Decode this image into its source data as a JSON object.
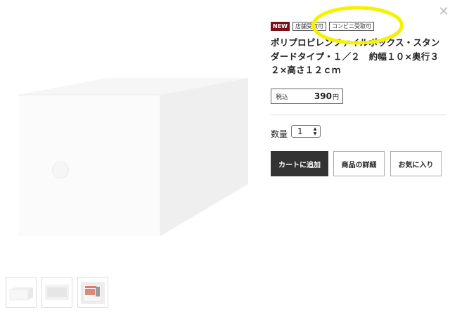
{
  "product": {
    "badges": {
      "new": "NEW",
      "store_pickup": "店舗受取可",
      "convenience_pickup": "コンビニ受取可"
    },
    "title": "ポリプロピレンファイルボックス・スタンダードタイプ・１／２　約幅１０×奥行３２×高さ１２ｃｍ",
    "price": {
      "tax_label": "税込",
      "value": "390",
      "unit": "円"
    }
  },
  "quantity": {
    "label": "数量",
    "value": "1",
    "up_icon": "chevron-up-icon",
    "down_icon": "chevron-down-icon"
  },
  "actions": {
    "add_to_cart": "カートに追加",
    "product_details": "商品の詳細",
    "favorite": "お気に入り"
  },
  "gallery": {
    "thumbnails": [
      "thumb-front",
      "thumb-top",
      "thumb-with-files"
    ]
  },
  "icons": {
    "close": "close-icon"
  },
  "colors": {
    "new_badge": "#7d0e1b",
    "cart_button": "#333333",
    "highlight": "#f5f200"
  }
}
